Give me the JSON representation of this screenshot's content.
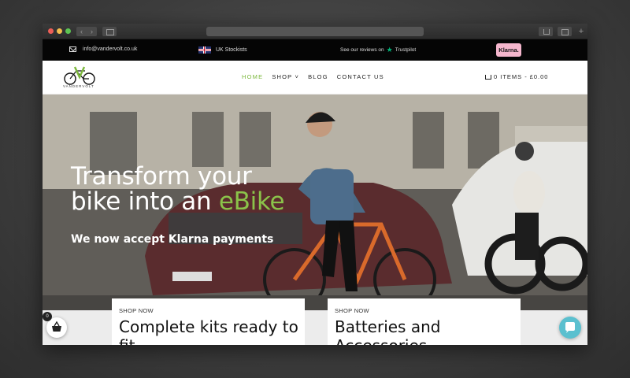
{
  "topbar": {
    "email": "info@vandervolt.co.uk",
    "stockist": "UK Stockists",
    "reviews": "See our reviews on",
    "trustpilot": "Trustpilot",
    "klarna": "Klarna."
  },
  "header": {
    "logo_text": "VANDERVOLT",
    "nav": [
      {
        "label": "HOME"
      },
      {
        "label": "SHOP"
      },
      {
        "label": "BLOG"
      },
      {
        "label": "CONTACT US"
      }
    ],
    "cart_items": "0 ITEMS",
    "cart_total": "£0.00"
  },
  "hero": {
    "title_line1": "Transform your",
    "title_line2_prefix": "bike into an ",
    "title_line2_highlight": "eBike",
    "subtitle": "We now accept Klarna payments"
  },
  "cards": [
    {
      "label": "SHOP NOW",
      "title": "Complete kits ready to fit"
    },
    {
      "label": "SHOP NOW",
      "title": "Batteries and Accessories"
    }
  ],
  "basket": {
    "count": "0"
  },
  "colors": {
    "accent_green": "#8bc34a",
    "klarna_pink": "#f5b6cd",
    "chat": "#5bc0cf"
  }
}
